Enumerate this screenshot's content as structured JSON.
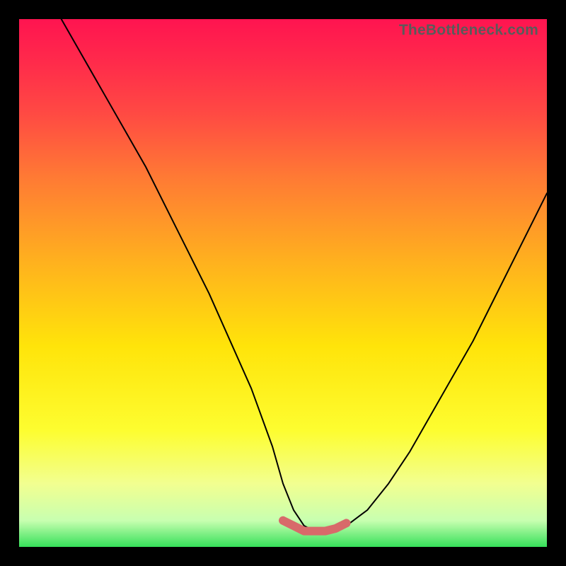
{
  "watermark": "TheBottleneck.com",
  "chart_data": {
    "type": "line",
    "title": "",
    "xlabel": "",
    "ylabel": "",
    "xlim": [
      0,
      100
    ],
    "ylim": [
      0,
      100
    ],
    "grid": false,
    "series": [
      {
        "name": "curve",
        "x": [
          8,
          12,
          16,
          20,
          24,
          28,
          32,
          36,
          40,
          44,
          48,
          50,
          52,
          54,
          56,
          58,
          60,
          62,
          66,
          70,
          74,
          78,
          82,
          86,
          90,
          94,
          98,
          100
        ],
        "y": [
          100,
          93,
          86,
          79,
          72,
          64,
          56,
          48,
          39,
          30,
          19,
          12,
          7,
          4,
          3,
          3,
          3,
          4,
          7,
          12,
          18,
          25,
          32,
          39,
          47,
          55,
          63,
          67
        ]
      }
    ],
    "highlight_segment": {
      "name": "bottom-band",
      "x": [
        50,
        52,
        54,
        56,
        58,
        60,
        62
      ],
      "y": [
        5,
        4,
        3,
        3,
        3,
        3.5,
        4.5
      ],
      "color": "#d86a6a"
    },
    "colors": {
      "curve": "#000000",
      "highlight": "#d86a6a",
      "gradient_top": "#ff1450",
      "gradient_mid": "#ffe40a",
      "gradient_bottom": "#36e05a",
      "frame": "#000000"
    }
  }
}
